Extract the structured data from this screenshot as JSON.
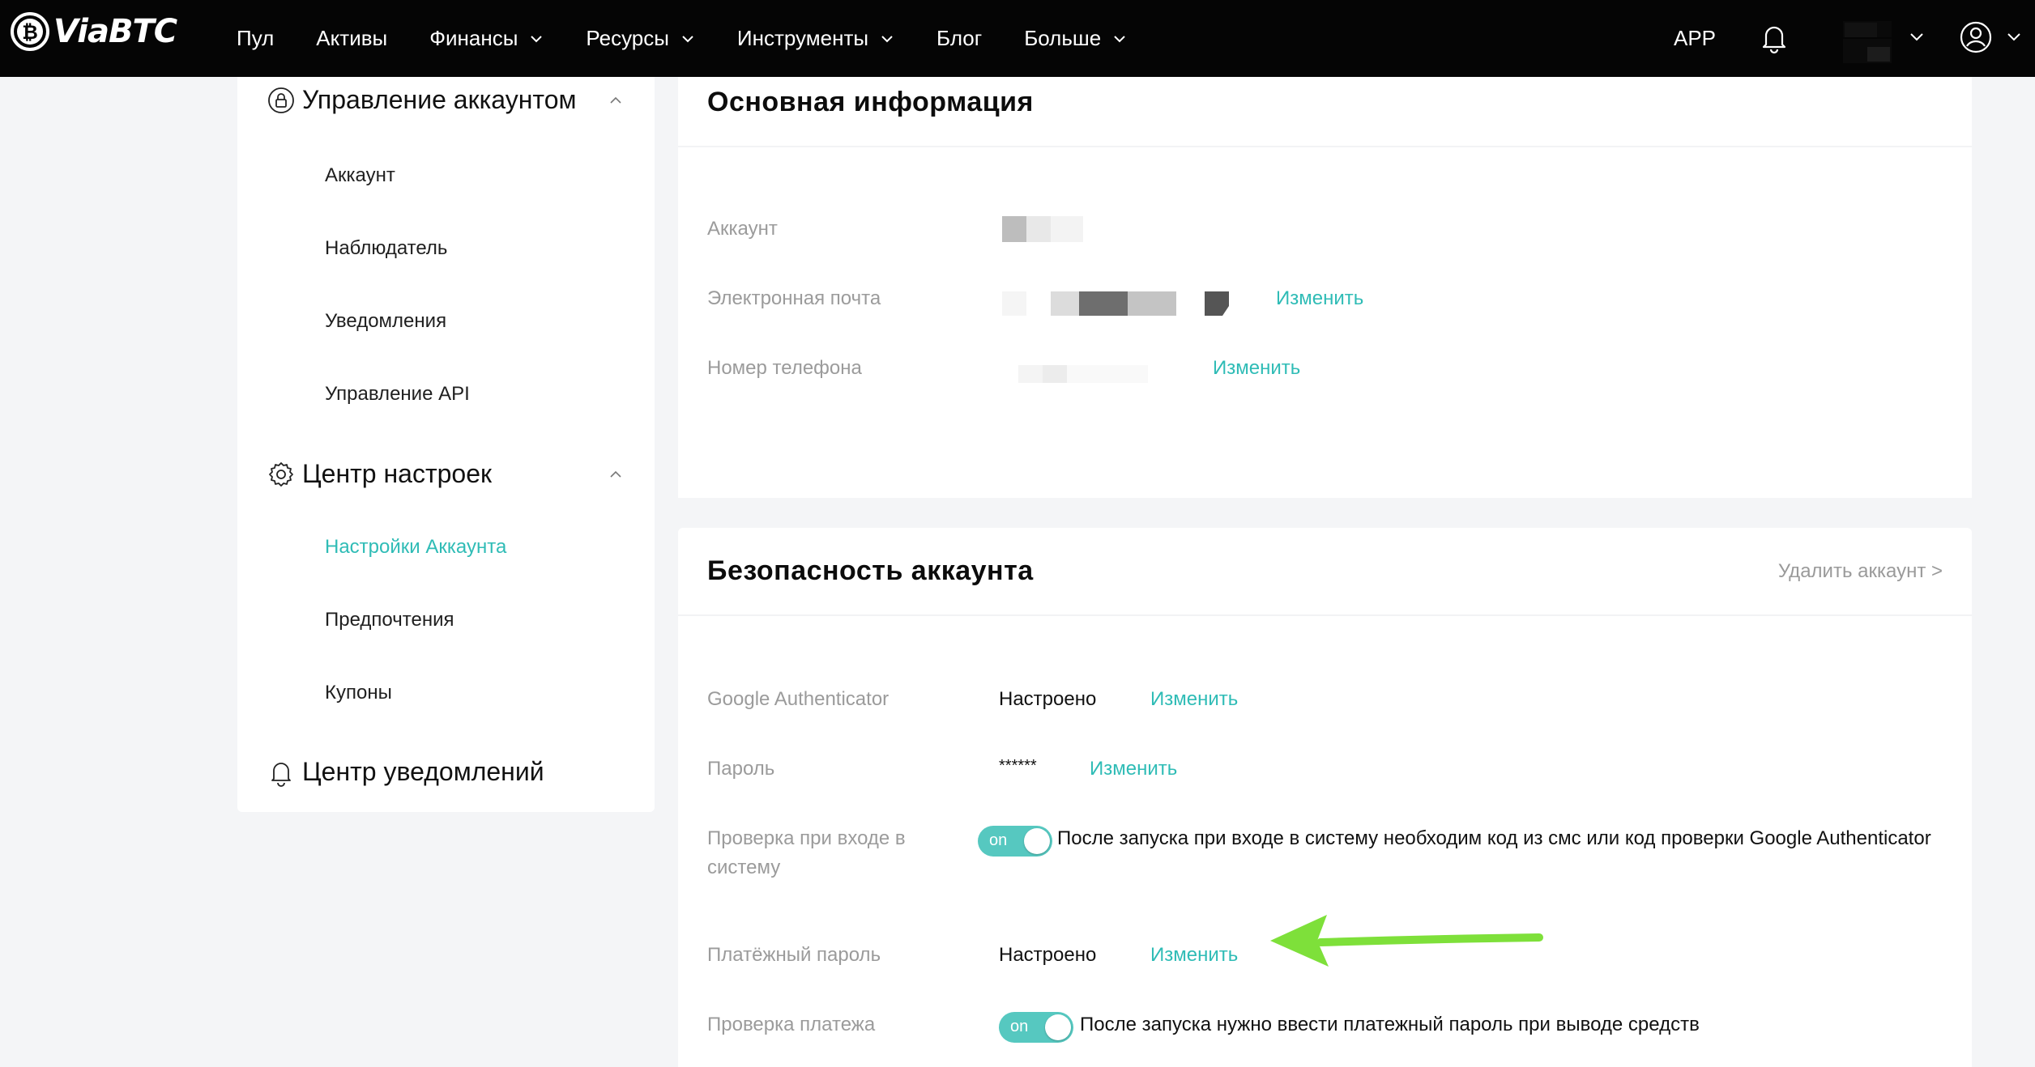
{
  "brand": {
    "name": "ViaBTC"
  },
  "nav": {
    "items": [
      {
        "label": "Пул",
        "dropdown": false
      },
      {
        "label": "Активы",
        "dropdown": false
      },
      {
        "label": "Финансы",
        "dropdown": true
      },
      {
        "label": "Ресурсы",
        "dropdown": true
      },
      {
        "label": "Инструменты",
        "dropdown": true
      },
      {
        "label": "Блог",
        "dropdown": false
      },
      {
        "label": "Больше",
        "dropdown": true
      }
    ],
    "app_label": "APP"
  },
  "sidebar": {
    "groups": [
      {
        "title": "Управление аккаунтом",
        "icon": "lock-circle-icon",
        "items": [
          "Аккаунт",
          "Наблюдатель",
          "Уведомления",
          "Управление API"
        ]
      },
      {
        "title": "Центр настроек",
        "icon": "gear-icon",
        "items": [
          "Настройки Аккаунта",
          "Предпочтения",
          "Купоны"
        ],
        "active_item": "Настройки Аккаунта"
      },
      {
        "title": "Центр уведомлений",
        "icon": "bell-icon",
        "items": []
      }
    ]
  },
  "basic_info": {
    "title": "Основная информация",
    "rows": [
      {
        "label": "Аккаунт",
        "value": "",
        "action": ""
      },
      {
        "label": "Электронная почта",
        "value": "",
        "action": "Изменить"
      },
      {
        "label": "Номер телефона",
        "value": "",
        "action": "Изменить"
      }
    ]
  },
  "security": {
    "title": "Безопасность аккаунта",
    "delete_link": "Удалить аккаунт >",
    "rows": [
      {
        "label": "Google Authenticator",
        "value": "Настроено",
        "action": "Изменить"
      },
      {
        "label": "Пароль",
        "value": "******",
        "action": "Изменить"
      },
      {
        "label": "Проверка при входе в систему",
        "toggle": "on",
        "description": "После запуска при входе в систему необходим код из смс или код проверки Google Authenticator"
      },
      {
        "label": "Платёжный пароль",
        "value": "Настроено",
        "action": "Изменить"
      },
      {
        "label": "Проверка платежа",
        "toggle": "on",
        "description": "После запуска нужно ввести платежный пароль при выводе средств"
      }
    ]
  },
  "colors": {
    "topbar_bg": "#050505",
    "page_bg": "#f4f5f7",
    "accent": "#2fbcb6",
    "toggle_bg": "#56c8c0",
    "label_gray": "#9b9b9b",
    "annotation_arrow": "#7ee03a"
  }
}
